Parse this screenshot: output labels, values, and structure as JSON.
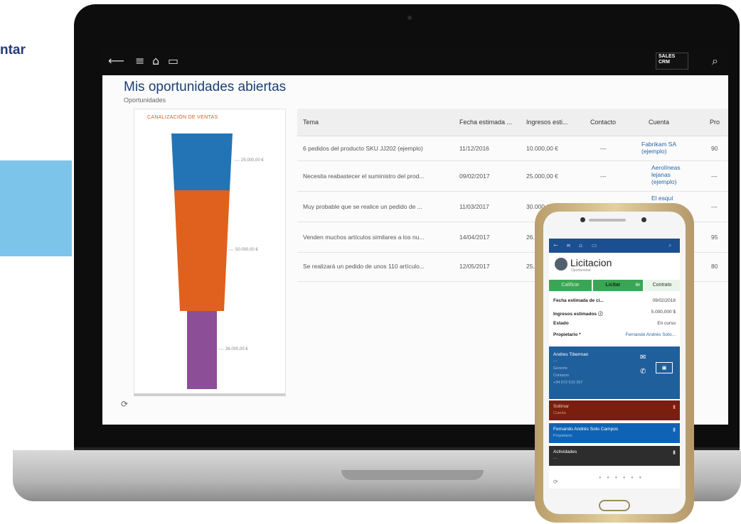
{
  "marketing": {
    "text": "ntar"
  },
  "app": {
    "brand": "SALES CRM",
    "page_title": "Mis oportunidades abiertas",
    "page_subtitle": "Oportunidades"
  },
  "funnel": {
    "caption": "CANALIZACIÓN DE VENTAS",
    "stage_labels": [
      "25.000,00 €",
      "50.000,00 €",
      "36.000,00 €"
    ],
    "colors": {
      "stage1": "#2374b5",
      "stage2": "#e0611e",
      "stage3": "#8c4e96"
    }
  },
  "table": {
    "headers": [
      "Tema",
      "Fecha estimada ...",
      "Ingresos esti...",
      "Contacto",
      "Cuenta",
      "Pro"
    ],
    "rows": [
      {
        "tema": "6 pedidos del producto SKU JJ202 (ejemplo)",
        "fecha": "11/12/2016",
        "ingresos": "10.000,00 €",
        "contacto": "---",
        "cuenta": "Fabrikam SA (ejemplo)",
        "pro": "90"
      },
      {
        "tema": "Necesita reabastecer el suministro del prod...",
        "fecha": "09/02/2017",
        "ingresos": "25.000,00 €",
        "contacto": "---",
        "cuenta": "Aerolíneas lejanas (ejemplo)",
        "pro": "---"
      },
      {
        "tema": "Muy probable que se realice un pedido de ...",
        "fecha": "11/03/2017",
        "ingresos": "30.000,00 €",
        "contacto": "---",
        "cuenta": "El esquí alpino",
        "pro": "---"
      },
      {
        "tema": "Venden muchos artículos similares a los nu...",
        "fecha": "14/04/2017",
        "ingresos": "26...",
        "contacto": "",
        "cuenta": "",
        "pro": "95"
      },
      {
        "tema": "Se realizará un pedido de unos 110 artículo...",
        "fecha": "12/05/2017",
        "ingresos": "25...",
        "contacto": "",
        "cuenta": "",
        "pro": "80"
      }
    ]
  },
  "phone": {
    "record_title": "Licitacion",
    "record_subtitle": "Oportunidad",
    "stages": [
      "Calificar",
      "Licitar",
      "Contrato"
    ],
    "stage_badge": "6h",
    "fields": [
      {
        "label": "Fecha estimada de ci...",
        "value": "09/02/2018"
      },
      {
        "label": "Ingresos estimados ⓘ",
        "value": "5.000,000 $"
      },
      {
        "label": "Estado",
        "value": "En curso"
      },
      {
        "label": "Propietario *",
        "value": "Fernando Andrés Soto..."
      }
    ],
    "contact_card": {
      "name": "Andres Tiberman",
      "line1": "---",
      "line2": "Gerente",
      "line3": "Contacto",
      "line4": "+34 672 510 307"
    },
    "account_card": {
      "name": "Sollmar",
      "sub": "Cuenta"
    },
    "owner_card": {
      "name": "Fernando Andrés Soto Campos",
      "sub": "Propietario"
    },
    "activities_card": {
      "name": "Actividades",
      "sub": "---"
    },
    "colors": {
      "bar": "#1c4f8f",
      "stage_green": "#3aa655",
      "account": "#7a1e10",
      "owner": "#0f63b4",
      "activities": "#2d2d2d",
      "contact": "#1f5f9c"
    }
  }
}
